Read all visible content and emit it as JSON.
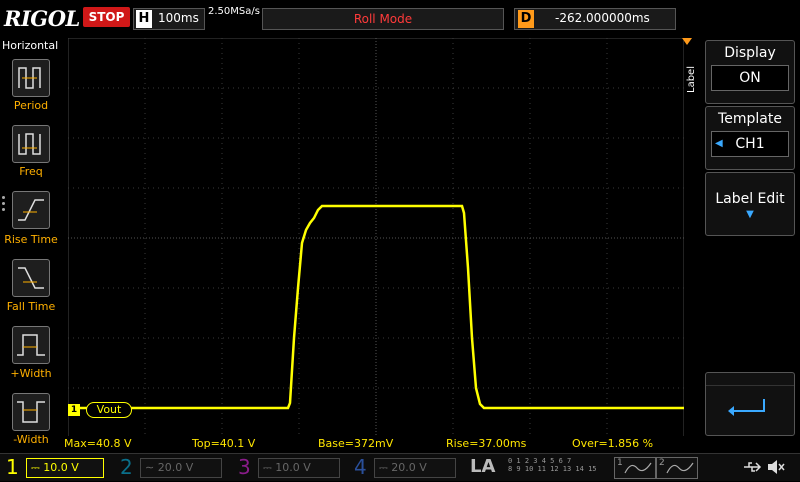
{
  "header": {
    "logo": "RIGOL",
    "run_status": "STOP",
    "timebase_letter": "H",
    "timebase": "100ms",
    "sample_rate": "2.50MSa/s",
    "mode": "Roll Mode",
    "delay_letter": "D",
    "delay": "-262.000000ms"
  },
  "left_menu": {
    "title": "Horizontal",
    "items": [
      "Period",
      "Freq",
      "Rise Time",
      "Fall Time",
      "+Width",
      "-Width"
    ]
  },
  "right_menu": {
    "tab": "Label",
    "keys": [
      {
        "title": "Display",
        "value": "ON"
      },
      {
        "title": "Template",
        "value": "CH1"
      },
      {
        "title": "Label Edit",
        "value": ""
      }
    ]
  },
  "waveform": {
    "channel_marker": "1",
    "label": "Vout",
    "color": "#ffff00"
  },
  "readouts": {
    "max": "Max=40.8 V",
    "top": "Top=40.1 V",
    "base": "Base=372mV",
    "rise": "Rise=37.00ms",
    "over": "Over=1.856 %"
  },
  "channels": [
    {
      "num": "1",
      "scale": "10.0 V",
      "color": "#ffff00"
    },
    {
      "num": "2",
      "scale": "20.0 V",
      "color": "#00c8ff"
    },
    {
      "num": "3",
      "scale": "10.0 V",
      "color": "#ff3aff"
    },
    {
      "num": "4",
      "scale": "20.0 V",
      "color": "#3a7dff"
    }
  ],
  "la_label": "LA",
  "la_digits_top": "0 1 2 3  4 5 6 7",
  "la_digits_bottom": "8 9 10 11  12 13 14 15",
  "math": [
    "1",
    "2"
  ]
}
